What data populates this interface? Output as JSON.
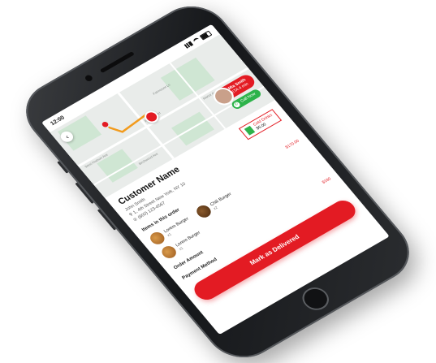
{
  "status_bar": {
    "time": "12:00"
  },
  "map": {
    "back_glyph": "‹",
    "road_labels": [
      "West Hudson Ave",
      "Redrand Rd",
      "Birchwood Ave",
      "Manor Ave",
      "Fairmount Ln"
    ],
    "driver": {
      "name": "Mia Smith",
      "subtitle": "ETA 4 min"
    },
    "call_button": "Call Now"
  },
  "customer": {
    "title": "Customer Name",
    "name": "John Smith",
    "address": "1, 4th Street New York, NY 10",
    "phone": "(800) 123-4567",
    "callout_label": "Cold Drinks",
    "callout_price": "$5.00"
  },
  "order": {
    "items_heading": "Items in this order",
    "items_total": "$170.00",
    "items": [
      {
        "name": "Lorem Burger",
        "qty": "x1"
      },
      {
        "name": "Chili Burger",
        "qty": "x2"
      },
      {
        "name": "Lorem Burger",
        "qty": "x1"
      }
    ],
    "amount_label": "Order Amount",
    "amount_value": "$180",
    "payment_label": "Payment Method",
    "cta_label": "Mark as Delivered"
  },
  "colors": {
    "accent": "#e31b23",
    "success": "#2db34a",
    "phone_body": "#1c1d20"
  }
}
